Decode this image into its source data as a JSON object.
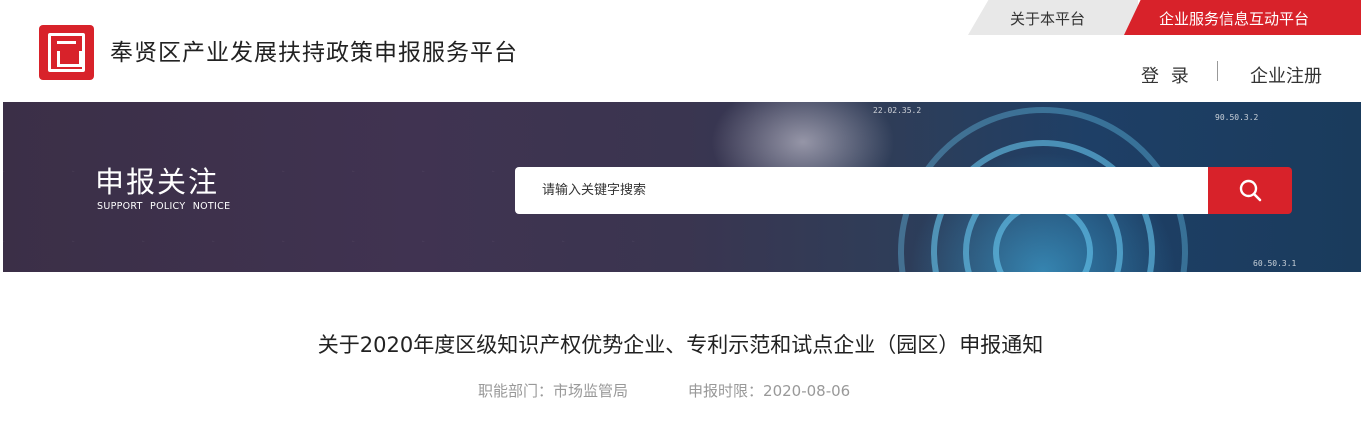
{
  "header": {
    "site_title": "奉贤区产业发展扶持政策申报服务平台",
    "logo_icon": "seal-logo-icon",
    "top_tabs": [
      {
        "label": "关于本平台"
      },
      {
        "label": "企业服务信息互动平台"
      }
    ],
    "login_label": "登 录",
    "register_label": "企业注册"
  },
  "banner": {
    "title": "申报关注",
    "subtitle": "SUPPORT POLICY NOTICE",
    "numbers": [
      "22.02.35.2",
      "90.50.3.2",
      "60.50.3.1"
    ]
  },
  "search": {
    "placeholder": "请输入关键字搜索",
    "button_icon": "search-icon"
  },
  "article": {
    "title": "关于2020年度区级知识产权优势企业、专利示范和试点企业（园区）申报通知",
    "department_label": "职能部门：",
    "department_value": "市场监管局",
    "deadline_label": "申报时限：",
    "deadline_value": "2020-08-06"
  },
  "colors": {
    "accent": "#d8222a",
    "tab_gray": "#e8e8e8"
  }
}
